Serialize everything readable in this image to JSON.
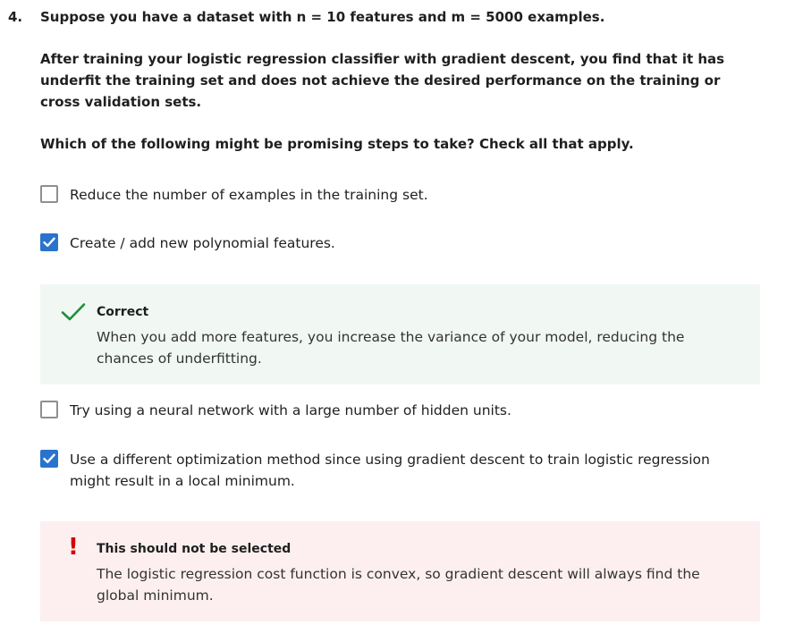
{
  "question": {
    "number": "4.",
    "intro": "Suppose you have a dataset with n = 10 features and m = 5000 examples.",
    "context": "After training your logistic regression classifier with gradient descent, you find that it has underfit the training set and does not achieve the desired performance on the training or cross validation sets.",
    "instruction": "Which of the following might be promising steps to take? Check all that apply."
  },
  "options": [
    {
      "label": "Reduce the number of examples in the training set.",
      "checked": false
    },
    {
      "label": "Create / add new polynomial features.",
      "checked": true,
      "feedback": {
        "status": "correct",
        "title": "Correct",
        "body": "When you add more features, you increase the variance of your model, reducing the chances of underfitting."
      }
    },
    {
      "label": "Try using a neural network with a large number of hidden units.",
      "checked": false
    },
    {
      "label": "Use a different optimization method since using gradient descent to train logistic regression might result in a local minimum.",
      "checked": true,
      "feedback": {
        "status": "incorrect",
        "title": "This should not be selected",
        "body": "The logistic regression cost function is convex, so gradient descent will always find the global minimum."
      }
    }
  ],
  "icons": {
    "correct": "checkmark-icon",
    "incorrect": "exclamation-icon",
    "checkbox_checked": "checkbox-checked-icon"
  },
  "colors": {
    "checkbox_checked": "#2a73cc",
    "correct_icon": "#1e8e3e",
    "correct_bg": "#f1f8f4",
    "incorrect_icon": "#d30001",
    "incorrect_bg": "#fdeff0"
  }
}
